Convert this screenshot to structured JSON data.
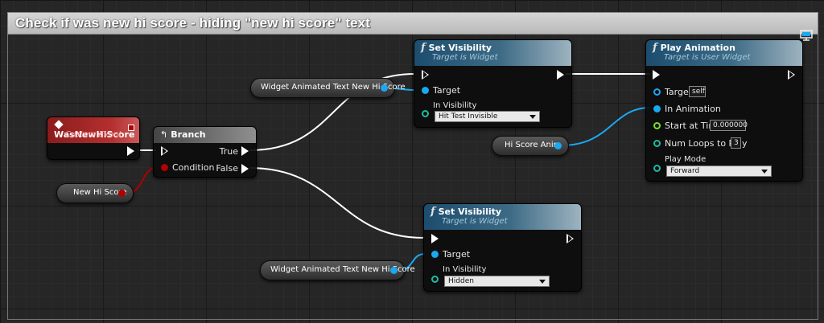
{
  "comment": {
    "title": "Check if was new hi score - hiding \"new hi score\" text"
  },
  "event_node": {
    "title": "WasNewHiScore",
    "subtitle": "Custom Event"
  },
  "branch_node": {
    "title": "Branch",
    "pin_true": "True",
    "pin_false": "False",
    "pin_condition": "Condition"
  },
  "set_vis_1": {
    "title": "Set Visibility",
    "subtitle": "Target is Widget",
    "pin_target": "Target",
    "pin_in_visibility": "In Visibility",
    "visibility_value": "Hit Test Invisible"
  },
  "set_vis_2": {
    "title": "Set Visibility",
    "subtitle": "Target is Widget",
    "pin_target": "Target",
    "pin_in_visibility": "In Visibility",
    "visibility_value": "Hidden"
  },
  "play_anim": {
    "title": "Play Animation",
    "subtitle": "Target is User Widget",
    "pin_target": "Target",
    "target_value": "self",
    "pin_in_animation": "In Animation",
    "pin_start_at_time": "Start at Time",
    "start_at_time_value": "0.000000",
    "pin_num_loops": "Num Loops to Play",
    "num_loops_value": "3",
    "pin_play_mode": "Play Mode",
    "play_mode_value": "Forward"
  },
  "var_widget_1": {
    "label": "Widget Animated Text New Hi Score"
  },
  "var_widget_2": {
    "label": "Widget Animated Text New Hi Score"
  },
  "var_hi_score_anim": {
    "label": "Hi Score Anim"
  },
  "var_new_hi_score": {
    "label": "New Hi Score"
  },
  "colors": {
    "exec": "#ffffff",
    "object": "#1aa8f0",
    "bool": "#b00000",
    "event_header": "#8a1c1c",
    "func_header": "#1d4d6e"
  },
  "icons": {
    "function": "f",
    "branch": "branch-icon",
    "event": "event-diamond-icon",
    "monitor": "monitor-icon"
  }
}
